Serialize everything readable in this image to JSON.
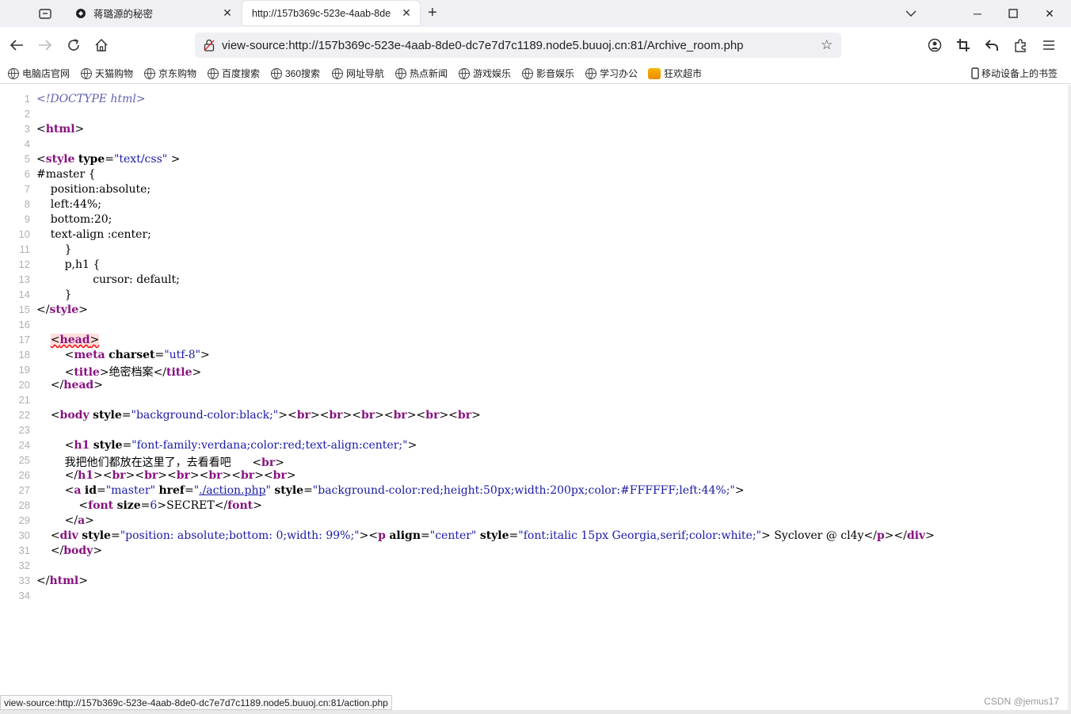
{
  "tabs": [
    {
      "title": "蒋璐源的秘密"
    },
    {
      "title": "http://157b369c-523e-4aab-8de"
    }
  ],
  "url": "view-source:http://157b369c-523e-4aab-8de0-dc7e7d7c1189.node5.buuoj.cn:81/Archive_room.php",
  "bookmarks": [
    "电脑店官网",
    "天猫购物",
    "京东购物",
    "百度搜索",
    "360搜索",
    "网址导航",
    "热点新闻",
    "游戏娱乐",
    "影音娱乐",
    "学习办公",
    "狂欢超市"
  ],
  "mobile_bookmarks": "移动设备上的书签",
  "source_lines": [
    "1",
    "2",
    "3",
    "4",
    "5",
    "6",
    "7",
    "8",
    "9",
    "10",
    "11",
    "12",
    "13",
    "14",
    "15",
    "16",
    "17",
    "18",
    "19",
    "20",
    "21",
    "22",
    "23",
    "24",
    "25",
    "26",
    "27",
    "28",
    "29",
    "30",
    "31",
    "32",
    "33",
    "34"
  ],
  "code": {
    "doctype": "<!DOCTYPE html>",
    "l6": "#master {",
    "l7": "    position:absolute;",
    "l8": "    left:44%;",
    "l9": "    bottom:20;",
    "l10": "    text-align :center;",
    "l11": "        }",
    "l12": "        p,h1 {",
    "l13": "                cursor: default;",
    "l14": "        }",
    "title_text": "绝密档案",
    "h1_text": "我把他们都放在这里了，去看看吧",
    "link_href": "./action.php",
    "font_text": "SECRET",
    "footer_text": " Syclover @ cl4y",
    "style_type": "\"text/css\"",
    "charset": "\"utf-8\"",
    "body_style": "\"background-color:black;\"",
    "h1_style": "\"font-family:verdana;color:red;text-align:center;\"",
    "a_id": "\"master\"",
    "a_style": "\"background-color:red;height:50px;width:200px;color:#FFFFFF;left:44%;\"",
    "font_size": "6",
    "div_style": "\"position: absolute;bottom: 0;width: 99%;\"",
    "p_align": "\"center\"",
    "p_style": "\"font:italic 15px Georgia,serif;color:white;\""
  },
  "status_url": "view-source:http://157b369c-523e-4aab-8de0-dc7e7d7c1189.node5.buuoj.cn:81/action.php",
  "watermark": "CSDN @jemus17"
}
